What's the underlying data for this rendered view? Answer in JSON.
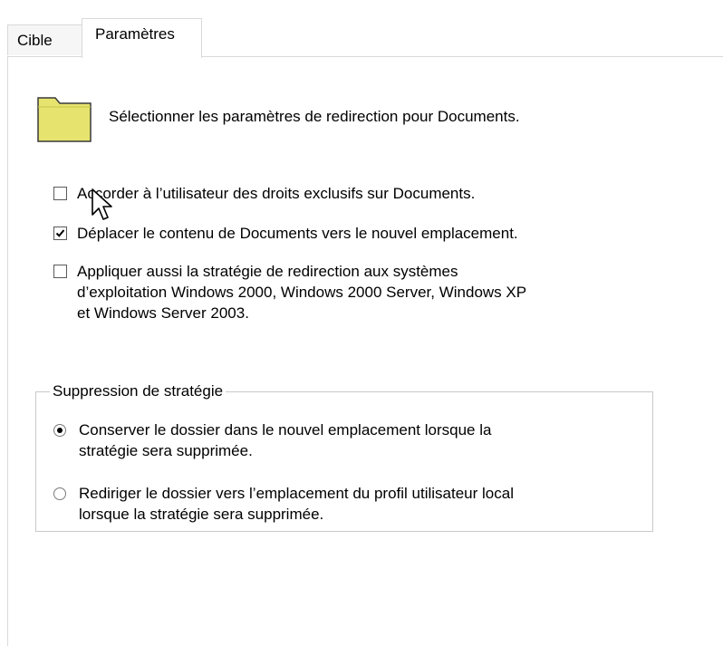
{
  "tabs": [
    {
      "label": "Cible",
      "selected": false
    },
    {
      "label": "Paramètres",
      "selected": true
    }
  ],
  "header": {
    "icon": "folder-icon",
    "description": "Sélectionner les paramètres de redirection pour Documents."
  },
  "options": {
    "exclusive_rights": {
      "label": "Accorder à l’utilisateur des droits exclusifs sur Documents.",
      "checked": false
    },
    "move_contents": {
      "label": "Déplacer le contenu de Documents vers le nouvel emplacement.",
      "checked": true
    },
    "legacy_os": {
      "label_line1": "Appliquer aussi la stratégie de redirection aux systèmes",
      "label_line2": "d’exploitation Windows 2000, Windows 2000 Server, Windows XP",
      "label_line3": "et Windows Server 2003.",
      "checked": false
    }
  },
  "policy_removal": {
    "legend": "Suppression de stratégie",
    "keep": {
      "line1": "Conserver le dossier dans le nouvel emplacement lorsque la",
      "line2": "stratégie sera supprimée.",
      "selected": true
    },
    "redirect_back": {
      "line1": "Rediriger le dossier vers l’emplacement du profil utilisateur local",
      "line2": "lorsque la stratégie sera supprimée.",
      "selected": false
    }
  },
  "colors": {
    "folder_fill": "#e6e46e",
    "folder_stroke": "#3a3a3a",
    "border": "#d9d9d9"
  }
}
